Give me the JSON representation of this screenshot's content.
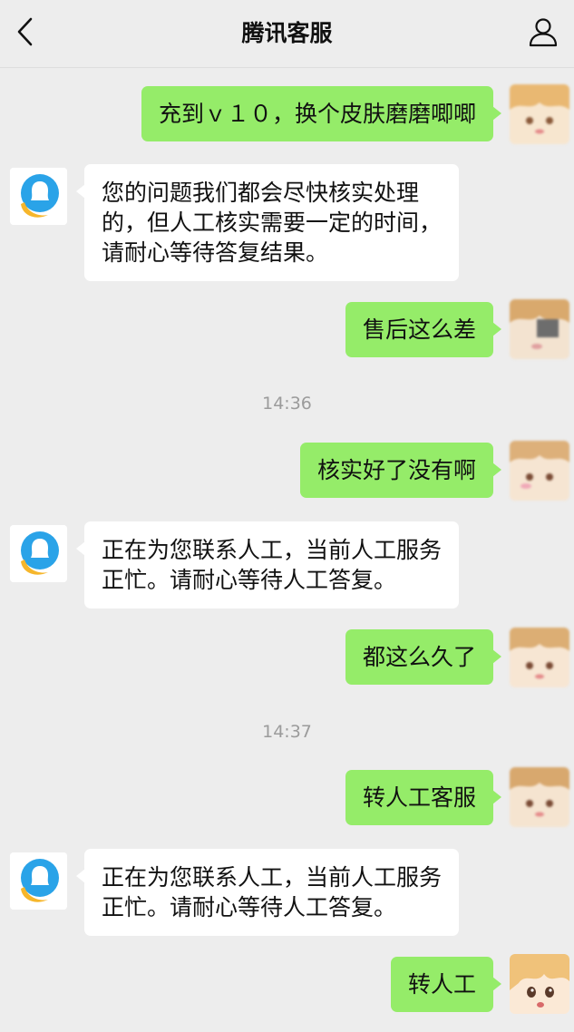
{
  "header": {
    "title": "腾讯客服",
    "back_icon": "chevron-left-icon",
    "profile_icon": "person-icon"
  },
  "colors": {
    "background": "#ededed",
    "me_bubble": "#95ec69",
    "them_bubble": "#ffffff",
    "timestamp": "#9b9b9b",
    "service_avatar_blue": "#2aa3e8",
    "service_avatar_yellow": "#f6b62b"
  },
  "messages": [
    {
      "sender": "me",
      "text": "充到ｖ１０，换个皮肤磨磨唧唧"
    },
    {
      "sender": "them",
      "text": "您的问题我们都会尽快核实处理\n的，但人工核实需要一定的时间，\n请耐心等待答复结果。"
    },
    {
      "sender": "me",
      "text": "售后这么差"
    },
    {
      "sender": "time",
      "text": "14:36"
    },
    {
      "sender": "me",
      "text": "核实好了没有啊"
    },
    {
      "sender": "them",
      "text": "正在为您联系人工，当前人工服务\n正忙。请耐心等待人工答复。"
    },
    {
      "sender": "me",
      "text": "都这么久了"
    },
    {
      "sender": "time",
      "text": "14:37"
    },
    {
      "sender": "me",
      "text": "转人工客服"
    },
    {
      "sender": "them",
      "text": "正在为您联系人工，当前人工服务\n正忙。请耐心等待人工答复。"
    },
    {
      "sender": "me",
      "text": "转人工"
    }
  ]
}
